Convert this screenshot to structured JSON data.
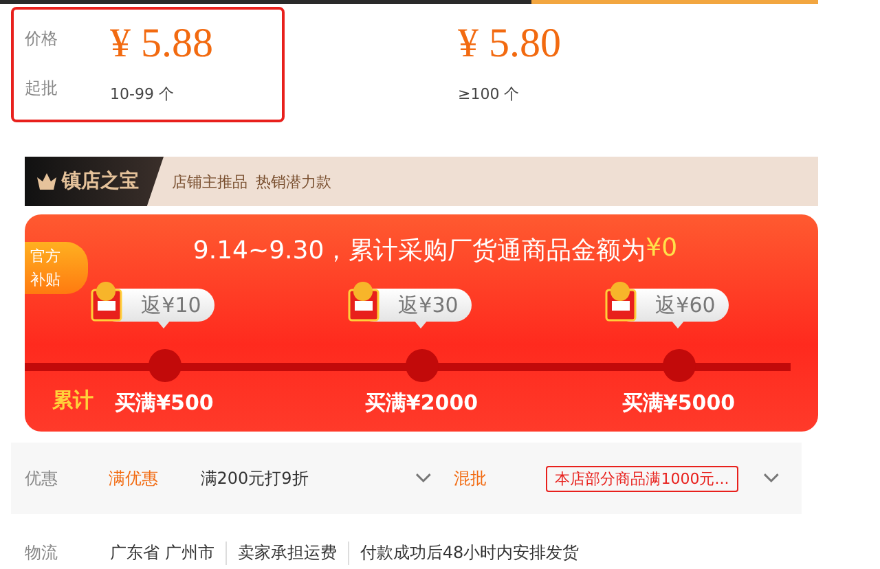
{
  "price_section": {
    "price_label": "价格",
    "qty_label": "起批",
    "tiers": [
      {
        "price": "¥ 5.88",
        "qty": "10-99 个",
        "selected": true
      },
      {
        "price": "¥ 5.80",
        "qty": "≥100 个",
        "selected": false
      }
    ]
  },
  "store_banner": {
    "badge": "镇店之宝",
    "tags": [
      "店铺主推品",
      "热销潜力款"
    ]
  },
  "promo_card": {
    "corner_badge": "官方补贴",
    "headline": "9.14~9.30，累计采购厂货通商品金额为",
    "amount": "¥0",
    "track_label": "累计",
    "milestones": [
      {
        "reward": "返¥10",
        "threshold": "买满¥500"
      },
      {
        "reward": "返¥30",
        "threshold": "买满¥2000"
      },
      {
        "reward": "返¥60",
        "threshold": "买满¥5000"
      }
    ]
  },
  "offers": {
    "label": "优惠",
    "discount_tag": "满优惠",
    "discount": "满200元打9折",
    "mix_tag": "混批",
    "mix_coupon": "本店部分商品满1000元..."
  },
  "logistics": {
    "label": "物流",
    "items": [
      "广东省 广州市",
      "卖家承担运费",
      "付款成功后48小时内安排发货"
    ]
  }
}
